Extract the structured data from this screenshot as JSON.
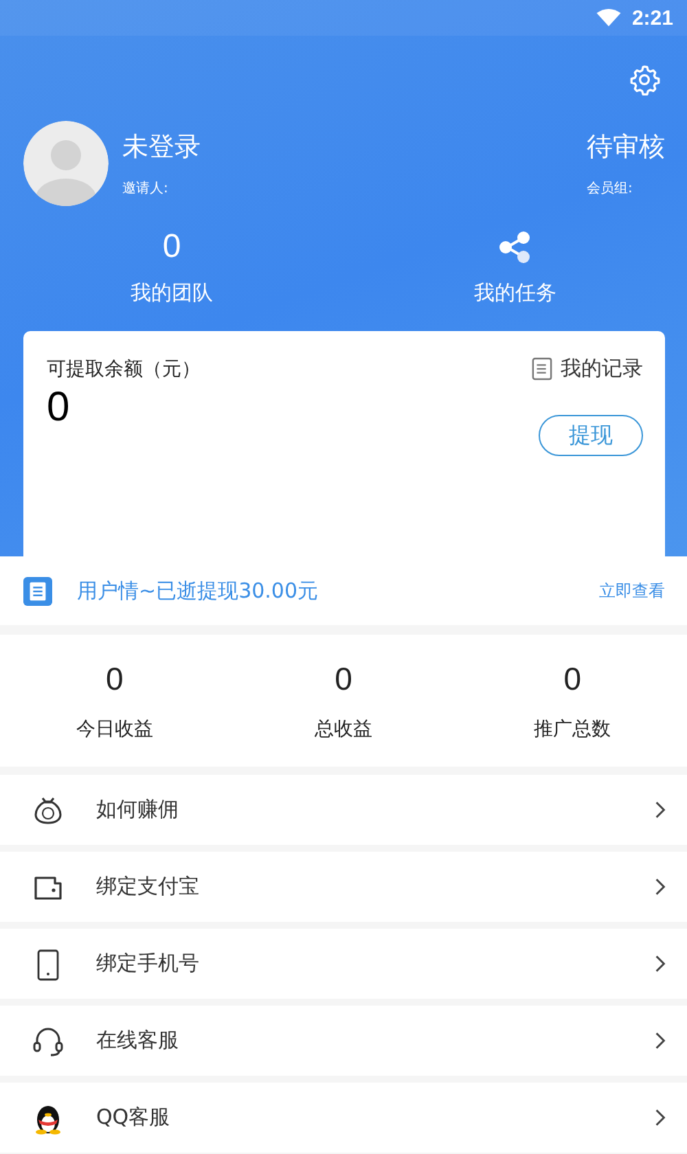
{
  "status_bar": {
    "time": "2:21"
  },
  "profile": {
    "name": "未登录",
    "inviter_label": "邀请人:",
    "status": "待审核",
    "group_label": "会员组:"
  },
  "header_stats": [
    {
      "kind": "count",
      "value": "0",
      "label": "我的团队"
    },
    {
      "kind": "share",
      "label": "我的任务"
    }
  ],
  "balance_card": {
    "title": "可提取余额（元）",
    "amount": "0",
    "records_link": "我的记录",
    "withdraw_button": "提现"
  },
  "notice": {
    "text": "用户情~已逝提现30.00元",
    "link": "立即查看"
  },
  "stats": [
    {
      "value": "0",
      "label": "今日收益"
    },
    {
      "value": "0",
      "label": "总收益"
    },
    {
      "value": "0",
      "label": "推广总数"
    }
  ],
  "menu": [
    {
      "kind": "money-bag",
      "label": "如何赚佣"
    },
    {
      "kind": "wallet",
      "label": "绑定支付宝"
    },
    {
      "kind": "phone",
      "label": "绑定手机号"
    },
    {
      "kind": "headset",
      "label": "在线客服"
    },
    {
      "kind": "penguin",
      "label": "QQ客服"
    }
  ]
}
